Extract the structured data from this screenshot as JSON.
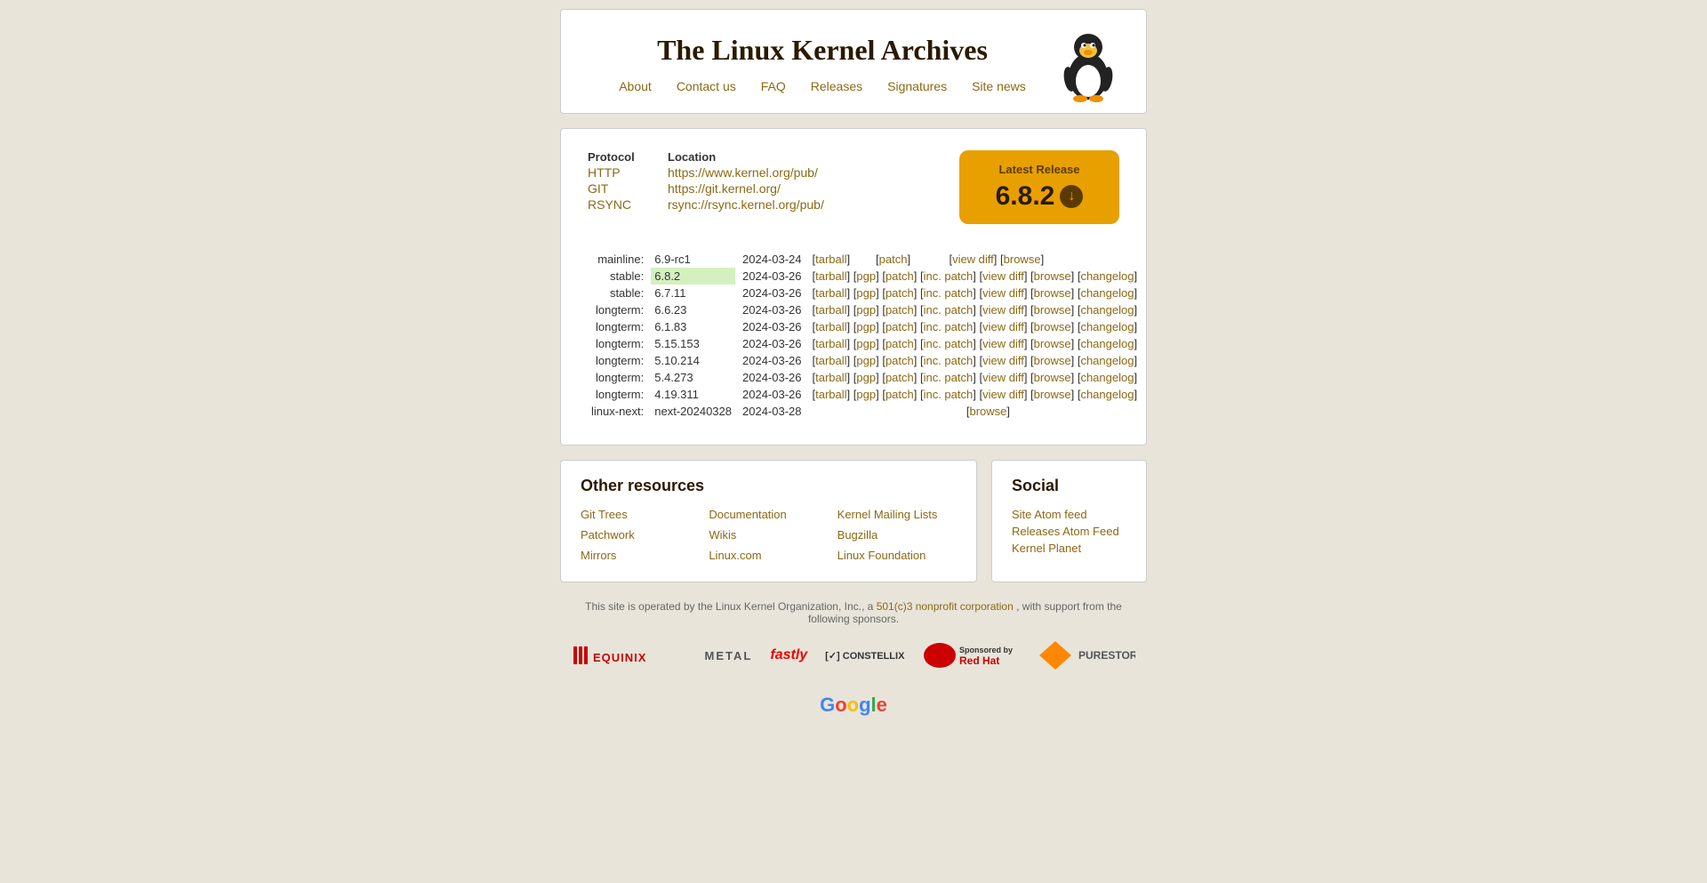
{
  "site": {
    "title": "The Linux Kernel Archives",
    "nav": [
      {
        "label": "About",
        "url": "#"
      },
      {
        "label": "Contact us",
        "url": "#"
      },
      {
        "label": "FAQ",
        "url": "#"
      },
      {
        "label": "Releases",
        "url": "#"
      },
      {
        "label": "Signatures",
        "url": "#"
      },
      {
        "label": "Site news",
        "url": "#"
      }
    ]
  },
  "protocols": {
    "header_protocol": "Protocol",
    "header_location": "Location",
    "rows": [
      {
        "label": "HTTP",
        "value": "https://www.kernel.org/pub/"
      },
      {
        "label": "GIT",
        "value": "https://git.kernel.org/"
      },
      {
        "label": "RSYNC",
        "value": "rsync://rsync.kernel.org/pub/"
      }
    ]
  },
  "latest_release": {
    "label": "Latest Release",
    "version": "6.8.2"
  },
  "releases": [
    {
      "type": "mainline:",
      "version": "6.9-rc1",
      "highlight": false,
      "date": "2024-03-24",
      "links": [
        "tarball",
        "patch",
        "view diff",
        "browse"
      ]
    },
    {
      "type": "stable:",
      "version": "6.8.2",
      "highlight": true,
      "date": "2024-03-26",
      "links": [
        "tarball",
        "pgp",
        "patch",
        "inc. patch",
        "view diff",
        "browse",
        "changelog"
      ]
    },
    {
      "type": "stable:",
      "version": "6.7.11",
      "highlight": false,
      "date": "2024-03-26",
      "links": [
        "tarball",
        "pgp",
        "patch",
        "inc. patch",
        "view diff",
        "browse",
        "changelog"
      ]
    },
    {
      "type": "longterm:",
      "version": "6.6.23",
      "highlight": false,
      "date": "2024-03-26",
      "links": [
        "tarball",
        "pgp",
        "patch",
        "inc. patch",
        "view diff",
        "browse",
        "changelog"
      ]
    },
    {
      "type": "longterm:",
      "version": "6.1.83",
      "highlight": false,
      "date": "2024-03-26",
      "links": [
        "tarball",
        "pgp",
        "patch",
        "inc. patch",
        "view diff",
        "browse",
        "changelog"
      ]
    },
    {
      "type": "longterm:",
      "version": "5.15.153",
      "highlight": false,
      "date": "2024-03-26",
      "links": [
        "tarball",
        "pgp",
        "patch",
        "inc. patch",
        "view diff",
        "browse",
        "changelog"
      ]
    },
    {
      "type": "longterm:",
      "version": "5.10.214",
      "highlight": false,
      "date": "2024-03-26",
      "links": [
        "tarball",
        "pgp",
        "patch",
        "inc. patch",
        "view diff",
        "browse",
        "changelog"
      ]
    },
    {
      "type": "longterm:",
      "version": "5.4.273",
      "highlight": false,
      "date": "2024-03-26",
      "links": [
        "tarball",
        "pgp",
        "patch",
        "inc. patch",
        "view diff",
        "browse",
        "changelog"
      ]
    },
    {
      "type": "longterm:",
      "version": "4.19.311",
      "highlight": false,
      "date": "2024-03-26",
      "links": [
        "tarball",
        "pgp",
        "patch",
        "inc. patch",
        "view diff",
        "browse",
        "changelog"
      ]
    },
    {
      "type": "linux-next:",
      "version": "next-20240328",
      "highlight": false,
      "date": "2024-03-28",
      "links": [
        "browse"
      ]
    }
  ],
  "other_resources": {
    "title": "Other resources",
    "links": [
      {
        "label": "Git Trees",
        "url": "#"
      },
      {
        "label": "Documentation",
        "url": "#"
      },
      {
        "label": "Kernel Mailing Lists",
        "url": "#"
      },
      {
        "label": "Patchwork",
        "url": "#"
      },
      {
        "label": "Wikis",
        "url": "#"
      },
      {
        "label": "Bugzilla",
        "url": "#"
      },
      {
        "label": "Mirrors",
        "url": "#"
      },
      {
        "label": "Linux.com",
        "url": "#"
      },
      {
        "label": "Linux Foundation",
        "url": "#"
      }
    ]
  },
  "social": {
    "title": "Social",
    "links": [
      {
        "label": "Site Atom feed",
        "url": "#"
      },
      {
        "label": "Releases Atom Feed",
        "url": "#"
      },
      {
        "label": "Kernel Planet",
        "url": "#"
      }
    ]
  },
  "footer": {
    "text": "This site is operated by the Linux Kernel Organization, Inc., a",
    "link_text": "501(c)3 nonprofit corporation",
    "text2": ", with support from the following sponsors."
  }
}
